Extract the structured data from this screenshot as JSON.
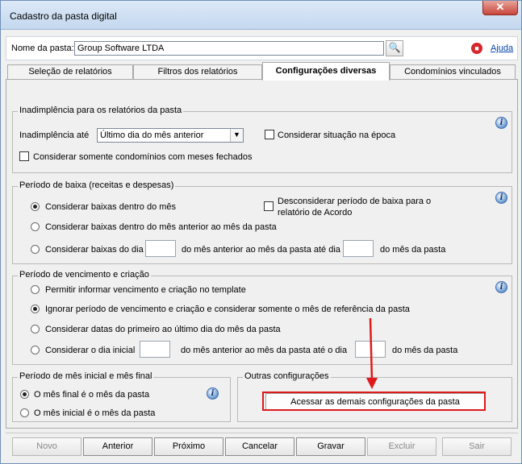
{
  "window": {
    "title": "Cadastro da pasta digital",
    "close_label": "✕"
  },
  "header": {
    "nome_label": "Nome da pasta:",
    "nome_value": "Group Software LTDA",
    "search_glyph": "🔍",
    "help_label": "Ajuda"
  },
  "tabs": [
    {
      "label": "Seleção de relatórios"
    },
    {
      "label": "Filtros dos relatórios"
    },
    {
      "label": "Configurações diversas"
    },
    {
      "label": "Condomínios vinculados"
    }
  ],
  "inadimplencia": {
    "title": "Inadimplência para os relatórios da pasta",
    "ate_label": "Inadimplência até",
    "ate_value": "Último dia do mês anterior",
    "epoca_label": "Considerar situação na época",
    "meses_fechados_label": "Considerar somente condomínios com meses fechados"
  },
  "baixa": {
    "title": "Período de baixa (receitas e despesas)",
    "opt1": "Considerar baixas dentro do mês",
    "opt2": "Considerar baixas dentro do mês anterior ao mês da pasta",
    "opt3_a": "Considerar baixas do dia",
    "opt3_b": "do mês anterior ao mês da pasta até dia",
    "opt3_c": "do mês da pasta",
    "desconsiderar_l1": "Desconsiderar período de baixa para o",
    "desconsiderar_l2": "relatório de Acordo"
  },
  "vencimento": {
    "title": "Período de vencimento e criação",
    "opt1": "Permitir informar vencimento e criação no template",
    "opt2": "Ignorar período de vencimento e criação e considerar somente o mês de referência da pasta",
    "opt3": "Considerar datas do primeiro ao último dia do mês da pasta",
    "opt4_a": "Considerar o dia inicial",
    "opt4_b": "do mês anterior ao mês da pasta até o dia",
    "opt4_c": "do mês da pasta"
  },
  "mes_inicial_final": {
    "title": "Período de mês inicial e mês final",
    "opt1": "O mês final é o mês da pasta",
    "opt2": "O mês inicial é o mês da pasta"
  },
  "outras": {
    "title": "Outras configurações",
    "button_label": "Acessar as demais configurações da pasta"
  },
  "footer": {
    "novo": "Novo",
    "anterior": "Anterior",
    "proximo": "Próximo",
    "cancelar": "Cancelar",
    "gravar": "Gravar",
    "excluir": "Excluir",
    "sair": "Sair"
  },
  "colors": {
    "highlight": "#e0191b",
    "link": "#0645ad"
  }
}
